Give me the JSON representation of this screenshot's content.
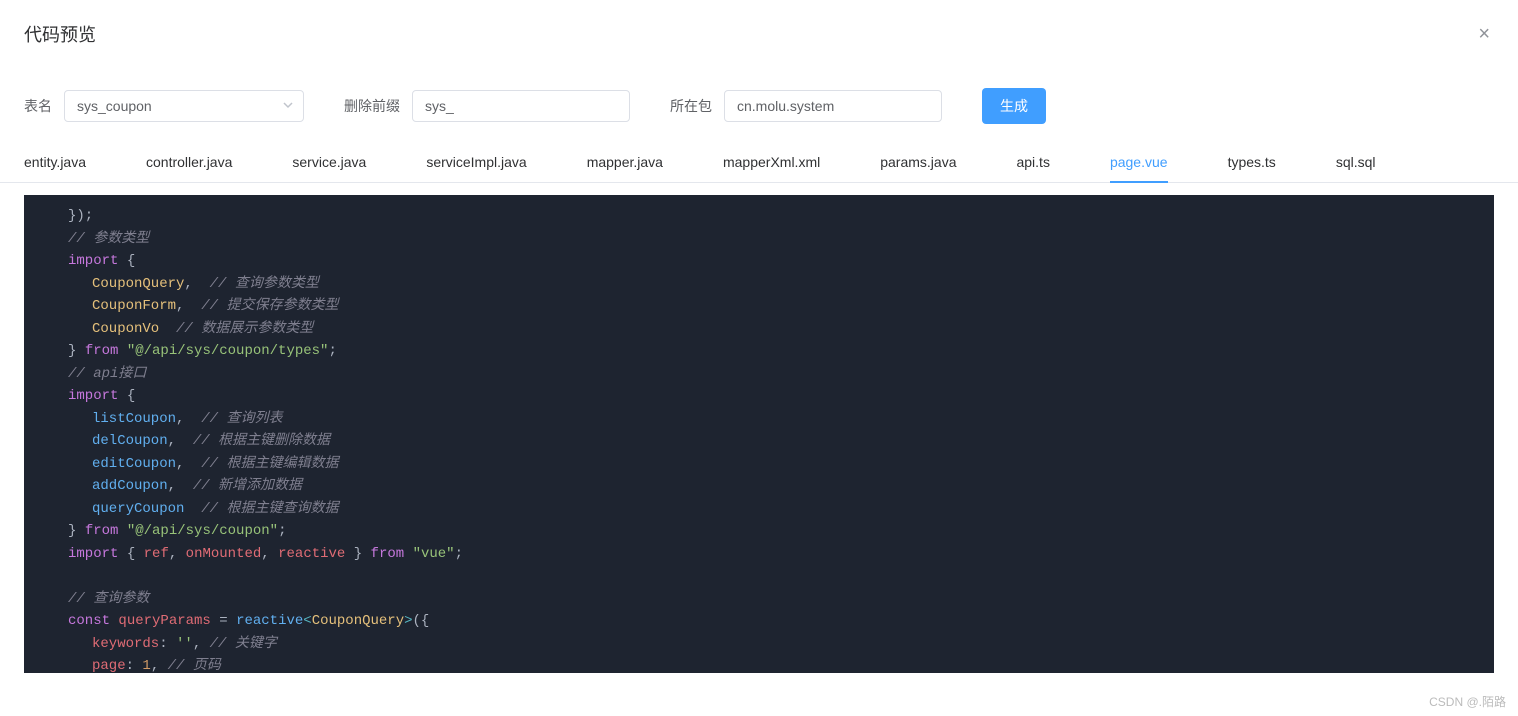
{
  "dialog": {
    "title": "代码预览",
    "close_icon": "×"
  },
  "form": {
    "table_name_label": "表名",
    "table_name_value": "sys_coupon",
    "prefix_label": "删除前缀",
    "prefix_value": "sys_",
    "package_label": "所在包",
    "package_value": "cn.molu.system",
    "generate_label": "生成"
  },
  "tabs": {
    "items": [
      {
        "label": "entity.java",
        "active": false
      },
      {
        "label": "controller.java",
        "active": false
      },
      {
        "label": "service.java",
        "active": false
      },
      {
        "label": "serviceImpl.java",
        "active": false
      },
      {
        "label": "mapper.java",
        "active": false
      },
      {
        "label": "mapperXml.xml",
        "active": false
      },
      {
        "label": "params.java",
        "active": false
      },
      {
        "label": "api.ts",
        "active": false
      },
      {
        "label": "page.vue",
        "active": true
      },
      {
        "label": "types.ts",
        "active": false
      },
      {
        "label": "sql.sql",
        "active": false
      }
    ]
  },
  "code": {
    "l0": "});",
    "l1": "// 参数类型",
    "l2_kw": "import",
    "l2_br": " {",
    "l3_a": "CouponQuery",
    "l3_c": ",  ",
    "l3_cm": "// 查询参数类型",
    "l4_a": "CouponForm",
    "l4_c": ",  ",
    "l4_cm": "// 提交保存参数类型",
    "l5_a": "CouponVo",
    "l5_c": "  ",
    "l5_cm": "// 数据展示参数类型",
    "l6_br": "} ",
    "l6_from": "from ",
    "l6_str": "\"@/api/sys/coupon/types\"",
    "l6_semi": ";",
    "l7": "// api接口",
    "l8_kw": "import",
    "l8_br": " {",
    "l9_a": "listCoupon",
    "l9_c": ",  ",
    "l9_cm": "// 查询列表",
    "l10_a": "delCoupon",
    "l10_c": ",  ",
    "l10_cm": "// 根据主键删除数据",
    "l11_a": "editCoupon",
    "l11_c": ",  ",
    "l11_cm": "// 根据主键编辑数据",
    "l12_a": "addCoupon",
    "l12_c": ",  ",
    "l12_cm": "// 新增添加数据",
    "l13_a": "queryCoupon",
    "l13_c": "  ",
    "l13_cm": "// 根据主键查询数据",
    "l14_br": "} ",
    "l14_from": "from ",
    "l14_str": "\"@/api/sys/coupon\"",
    "l14_semi": ";",
    "l15_kw": "import",
    "l15_br1": " { ",
    "l15_ref": "ref",
    "l15_c1": ", ",
    "l15_om": "onMounted",
    "l15_c2": ", ",
    "l15_re": "reactive",
    "l15_br2": " } ",
    "l15_from": "from ",
    "l15_str": "\"vue\"",
    "l15_semi": ";",
    "l17": "// 查询参数",
    "l18_const": "const ",
    "l18_qp": "queryParams",
    "l18_eq": " = ",
    "l18_re": "reactive",
    "l18_lt": "<",
    "l18_cq": "CouponQuery",
    "l18_gt": ">",
    "l18_par": "({",
    "l19_k": "keywords",
    "l19_col": ": ",
    "l19_v": "''",
    "l19_c": ", ",
    "l19_cm": "// 关键字",
    "l20_k": "page",
    "l20_col": ": ",
    "l20_v": "1",
    "l20_c": ", ",
    "l20_cm": "// 页码"
  },
  "watermark": "CSDN @.陌路"
}
